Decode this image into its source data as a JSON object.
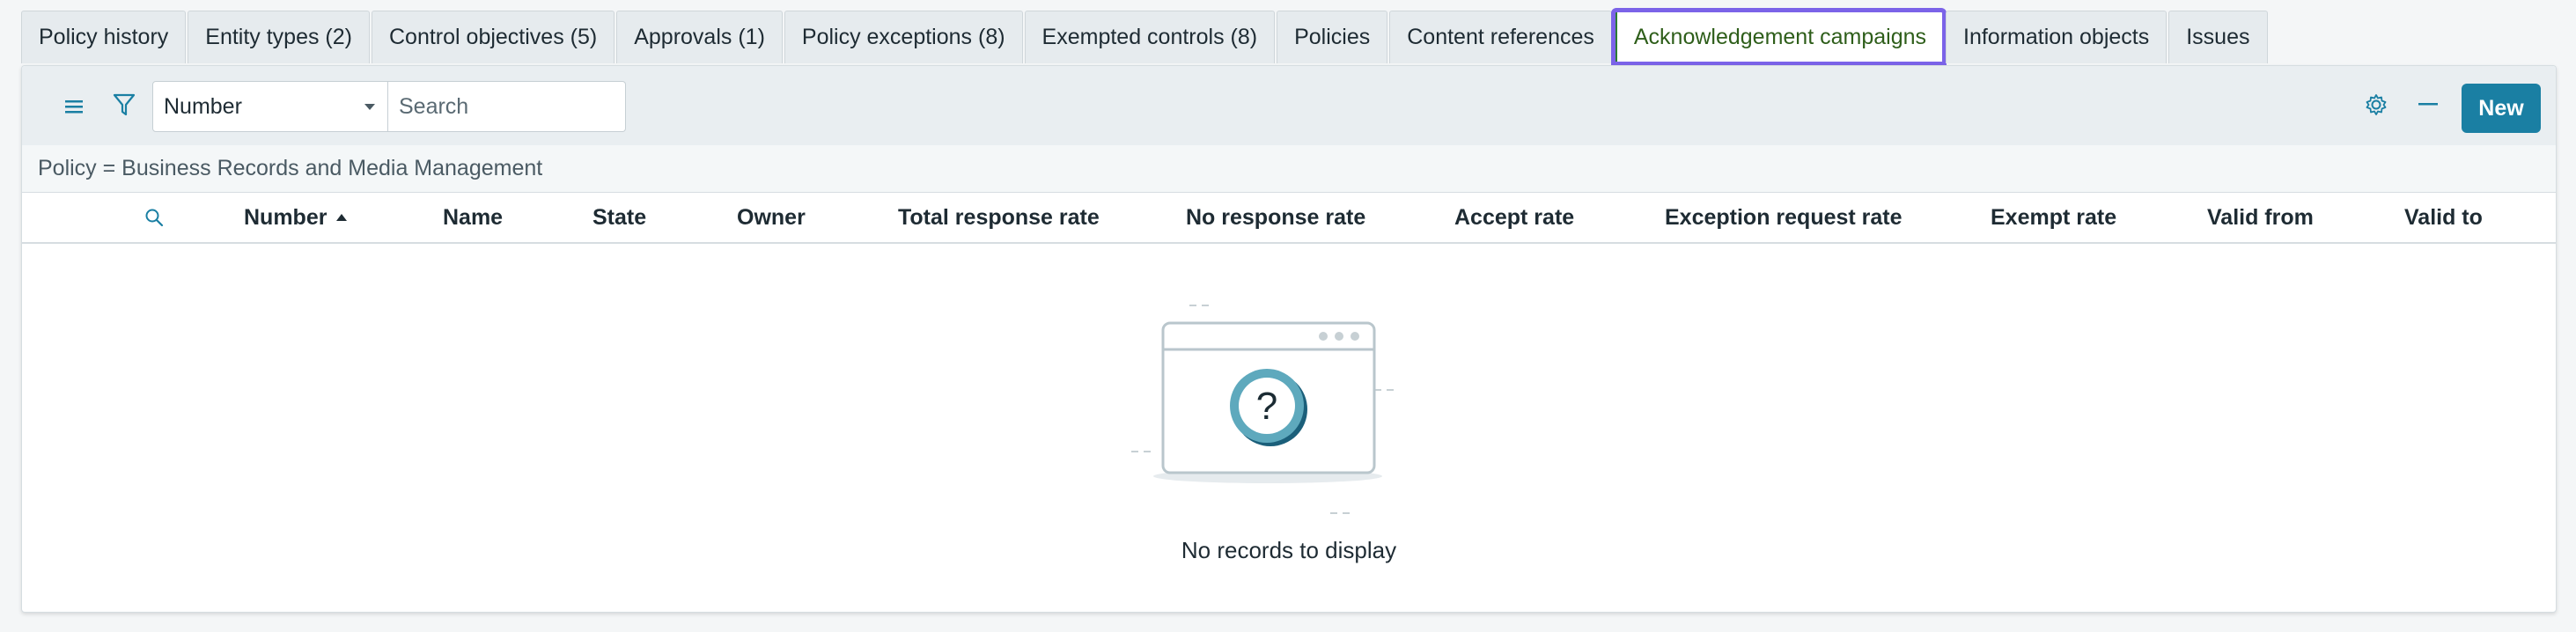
{
  "tabs": [
    {
      "label": "Policy history"
    },
    {
      "label": "Entity types (2)"
    },
    {
      "label": "Control objectives (5)"
    },
    {
      "label": "Approvals (1)"
    },
    {
      "label": "Policy exceptions (8)"
    },
    {
      "label": "Exempted controls (8)"
    },
    {
      "label": "Policies"
    },
    {
      "label": "Content references"
    },
    {
      "label": "Acknowledgement campaigns"
    },
    {
      "label": "Information objects"
    },
    {
      "label": "Issues"
    }
  ],
  "toolbar": {
    "field_select": "Number",
    "search_placeholder": "Search",
    "new_label": "New"
  },
  "filter": {
    "condition": "Policy = Business Records and Media Management"
  },
  "columns": [
    {
      "label": "Number",
      "sorted": "ascending"
    },
    {
      "label": "Name"
    },
    {
      "label": "State"
    },
    {
      "label": "Owner"
    },
    {
      "label": "Total response rate"
    },
    {
      "label": "No response rate"
    },
    {
      "label": "Accept rate"
    },
    {
      "label": "Exception request rate"
    },
    {
      "label": "Exempt rate"
    },
    {
      "label": "Valid from"
    },
    {
      "label": "Valid to"
    }
  ],
  "empty_state": {
    "message": "No records to display"
  },
  "colors": {
    "accent": "#1a7fa3",
    "active_tab_outline": "#7b63e8",
    "active_tab_text": "#2e5e1a"
  }
}
